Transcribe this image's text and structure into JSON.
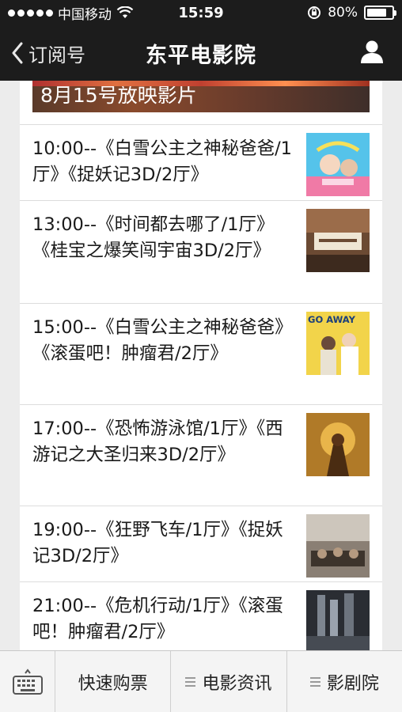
{
  "status_bar": {
    "carrier": "中国移动",
    "time": "15:59",
    "battery": "80%",
    "battery_level": 0.8
  },
  "nav": {
    "back_label": "订阅号",
    "title": "东平电影院"
  },
  "banner": {
    "text": "8月15号放映影片"
  },
  "showtimes": [
    {
      "text": "10:00--《白雪公主之神秘爸爸/1厅》《捉妖记3D/2厅》"
    },
    {
      "text": "13:00--《时间都去哪了/1厅》《桂宝之爆笑闯宇宙3D/2厅》"
    },
    {
      "text": "15:00--《白雪公主之神秘爸爸》《滚蛋吧！肿瘤君/2厅》"
    },
    {
      "text": "17:00--《恐怖游泳馆/1厅》《西游记之大圣归来3D/2厅》"
    },
    {
      "text": "19:00--《狂野飞车/1厅》《捉妖记3D/2厅》"
    },
    {
      "text": "21:00--《危机行动/1厅》《滚蛋吧！肿瘤君/2厅》"
    }
  ],
  "poster_text": {
    "p3": "GO AWAY"
  },
  "tabbar": {
    "tab1": "快速购票",
    "tab2": "电影资讯",
    "tab3": "影剧院"
  }
}
